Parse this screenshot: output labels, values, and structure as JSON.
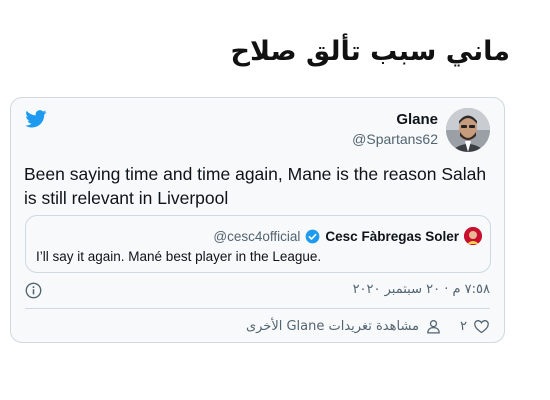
{
  "headline": "ماني سبب تألق صلاح",
  "tweet": {
    "author_name": "Glane",
    "author_handle": "@Spartans62",
    "text": "Been saying time and time again, Mane is the reason Salah is still relevant in Liverpool",
    "timestamp": "٧:٥٨ م · ٢٠ سبتمبر ٢٠٢٠",
    "like_count": "٢",
    "see_more": "مشاهدة تغريدات Glane الأخرى"
  },
  "quoted_tweet": {
    "author_name": "Cesc Fàbregas Soler",
    "author_handle": "@cesc4official",
    "text": "I’ll say it again. Mané best player in the League."
  },
  "colors": {
    "twitter_blue": "#1d9bf0",
    "card_bg": "#f7f9fa",
    "border": "#cfd9de",
    "secondary_text": "#536471"
  },
  "icons": [
    "twitter-bird-icon",
    "verified-badge-icon",
    "info-icon",
    "heart-icon",
    "person-icon"
  ]
}
